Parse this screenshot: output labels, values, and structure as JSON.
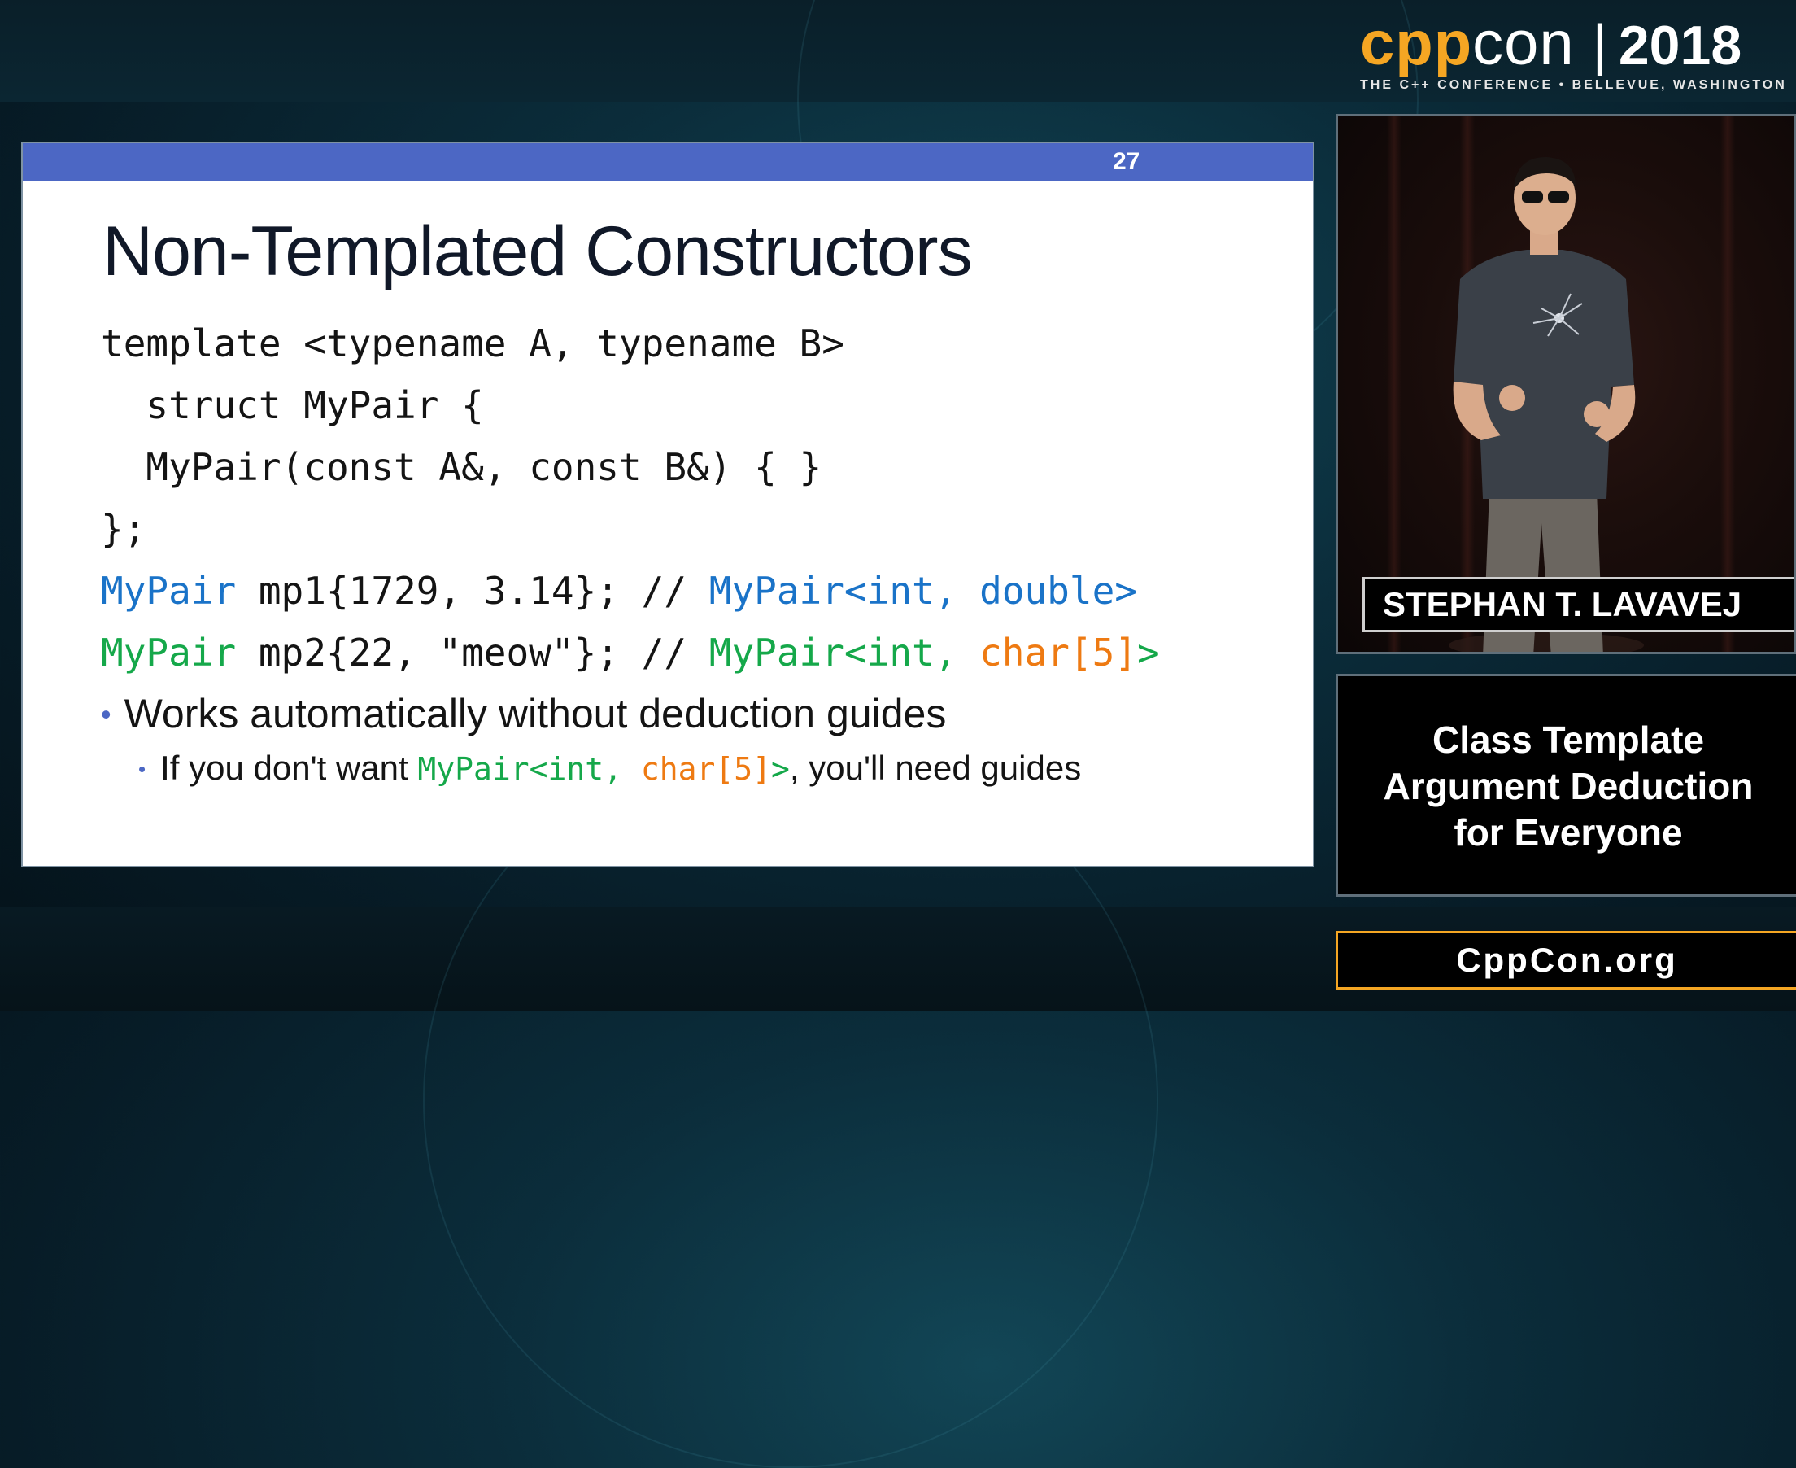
{
  "logo": {
    "cpp": "cpp",
    "con": "con",
    "separator": "|",
    "year": "2018",
    "tagline": "THE C++ CONFERENCE • BELLEVUE, WASHINGTON"
  },
  "slide": {
    "number": "27",
    "title": "Non-Templated Constructors",
    "code": {
      "line1": "template <typename A, typename B>",
      "line2": "  struct MyPair {",
      "line3": "  MyPair(const A&, const B&) { }",
      "line4": "};",
      "line5": {
        "type": "MyPair",
        "expr": " mp1{1729, 3.14}; // ",
        "result": "MyPair<int, double>"
      },
      "line6": {
        "type": "MyPair",
        "expr": " mp2{22, \"meow\"}; // ",
        "result_a": "MyPair<int, ",
        "result_b": "char[5]",
        "result_c": ">"
      }
    },
    "bullet": "Works automatically without deduction guides",
    "subbullet": {
      "pre": "If you don't want ",
      "code_a": "MyPair<int, ",
      "code_b": "char[5]",
      "code_c": ">",
      "post": ", you'll need guides"
    }
  },
  "speaker": {
    "name": "STEPHAN T. LAVAVEJ"
  },
  "talk": {
    "title_line1": "Class Template",
    "title_line2": "Argument Deduction",
    "title_line3": "for Everyone"
  },
  "site": "CppCon.org",
  "colors": {
    "brand_orange": "#f5a623",
    "slide_bar": "#4c67c4",
    "code_blue": "#1a73c8",
    "code_green": "#15a84a",
    "code_orange": "#ee7a12"
  }
}
